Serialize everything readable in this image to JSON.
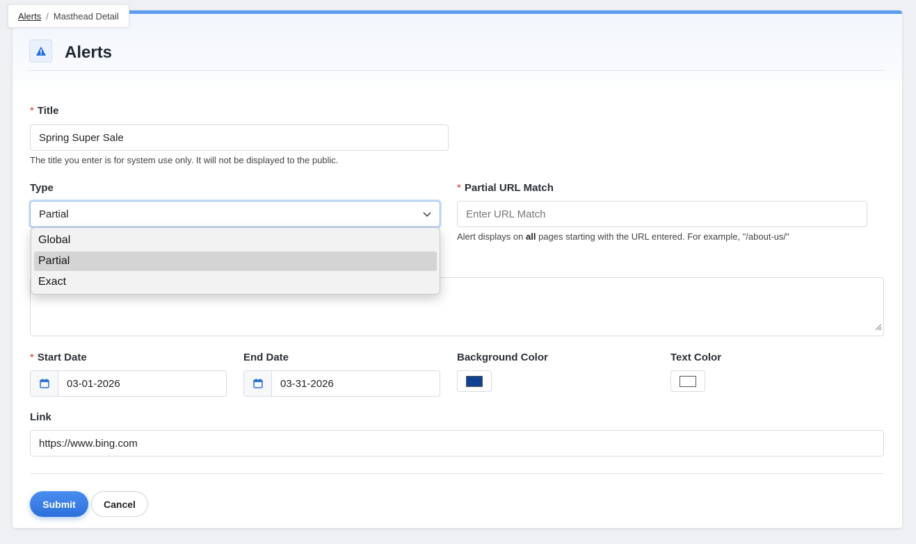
{
  "breadcrumb": {
    "root": "Alerts",
    "separator": "/",
    "current": "Masthead Detail"
  },
  "header": {
    "title": "Alerts",
    "icon": "warning-icon"
  },
  "form": {
    "title": {
      "label": "Title",
      "required_mark": "*",
      "value": "Spring Super Sale",
      "help": "The title you enter is for system use only. It will not be displayed to the public."
    },
    "type": {
      "label": "Type",
      "value": "Partial",
      "options": [
        "Global",
        "Partial",
        "Exact"
      ],
      "selected_option": "Partial"
    },
    "partial_url": {
      "label": "Partial URL Match",
      "required_mark": "*",
      "placeholder": "Enter URL Match",
      "help_prefix": "Alert displays on ",
      "help_bold": "all",
      "help_suffix": " pages starting with the URL entered. For example, \"/about-us/\""
    },
    "start_date": {
      "label": "Start Date",
      "required_mark": "*",
      "value": "03-01-2026"
    },
    "end_date": {
      "label": "End Date",
      "value": "03-31-2026"
    },
    "background_color": {
      "label": "Background Color",
      "value": "#0f4291"
    },
    "text_color": {
      "label": "Text Color",
      "value": "#ffffff"
    },
    "link": {
      "label": "Link",
      "value": "https://www.bing.com"
    }
  },
  "actions": {
    "submit": "Submit",
    "cancel": "Cancel"
  },
  "colors": {
    "accent": "#3b82f6",
    "required": "#d9342b",
    "top_border": "#5b9cf0"
  }
}
